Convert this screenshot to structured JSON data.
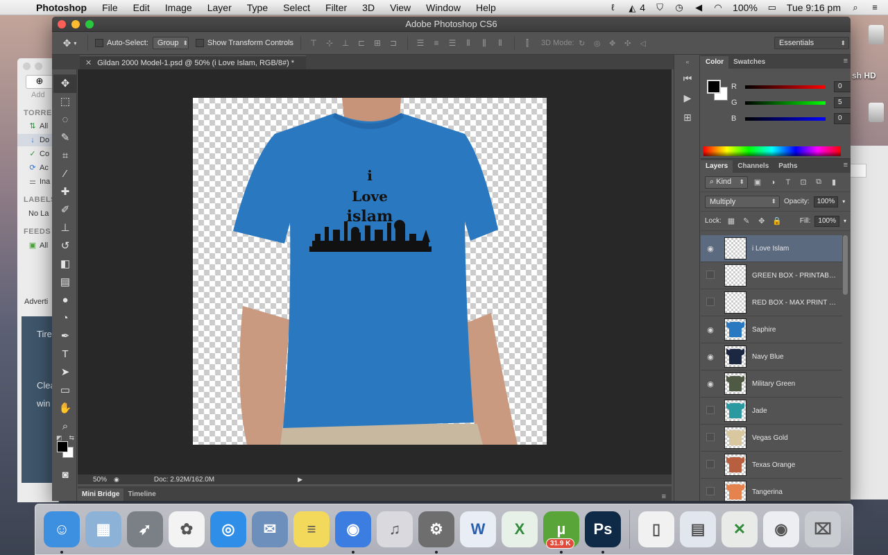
{
  "menubar": {
    "app": "Photoshop",
    "items": [
      "File",
      "Edit",
      "Image",
      "Layer",
      "Type",
      "Select",
      "Filter",
      "3D",
      "View",
      "Window",
      "Help"
    ],
    "adobe_count": "4",
    "battery": "100%",
    "clock": "Tue 9:16 pm"
  },
  "bg_app": {
    "add_label": "Add",
    "sections": [
      "TORRE",
      "LABELS",
      "FEEDS"
    ],
    "rows": [
      "All",
      "Do",
      "Co",
      "Ac",
      "Ina"
    ],
    "label_row": "No La",
    "feed_row": "All",
    "ad_label": "Adverti",
    "ad_lines": [
      "Tire",
      "Clea",
      "win"
    ]
  },
  "desktop": {
    "drive_label": "sh HD"
  },
  "ps": {
    "window_title": "Adobe Photoshop CS6",
    "options": {
      "auto_select": "Auto-Select:",
      "auto_select_value": "Group",
      "show_transform": "Show Transform Controls",
      "mode3d": "3D Mode:",
      "workspace": "Essentials"
    },
    "doc_tab": "Gildan 2000 Model-1.psd @ 50% (i Love Islam, RGB/8#) *",
    "status": {
      "zoom": "50%",
      "doc": "Doc: 2.92M/162.0M"
    },
    "bottom_tabs": [
      "Mini Bridge",
      "Timeline"
    ],
    "artwork": {
      "line1": "i",
      "line2": "Love",
      "line3": "islam",
      "shirt_color": "#2a78c0"
    },
    "color_panel": {
      "tabs": [
        "Color",
        "Swatches"
      ],
      "channels": [
        {
          "label": "R",
          "value": "0",
          "grad": "linear-gradient(90deg,#000,#ff0000)"
        },
        {
          "label": "G",
          "value": "5",
          "grad": "linear-gradient(90deg,#000,#00ff00)"
        },
        {
          "label": "B",
          "value": "0",
          "grad": "linear-gradient(90deg,#000,#0000ff)"
        }
      ]
    },
    "layers_panel": {
      "tabs": [
        "Layers",
        "Channels",
        "Paths"
      ],
      "filter": "Kind",
      "blend_mode": "Multiply",
      "opacity_label": "Opacity:",
      "opacity": "100%",
      "lock_label": "Lock:",
      "fill_label": "Fill:",
      "fill": "100%",
      "layers": [
        {
          "name": "i Love Islam",
          "visible": true,
          "selected": true,
          "color": null
        },
        {
          "name": "GREEN BOX - PRINTABLE ...",
          "visible": false,
          "selected": false,
          "color": null
        },
        {
          "name": "RED BOX - MAX PRINT SIZE",
          "visible": false,
          "selected": false,
          "color": null
        },
        {
          "name": "Saphire",
          "visible": true,
          "selected": false,
          "color": "#2a78c0"
        },
        {
          "name": "Navy Blue",
          "visible": true,
          "selected": false,
          "color": "#1c2741"
        },
        {
          "name": "Military Green",
          "visible": true,
          "selected": false,
          "color": "#4f5a45"
        },
        {
          "name": "Jade",
          "visible": false,
          "selected": false,
          "color": "#2b9aa0"
        },
        {
          "name": "Vegas Gold",
          "visible": false,
          "selected": false,
          "color": "#d9c7a0"
        },
        {
          "name": "Texas Orange",
          "visible": false,
          "selected": false,
          "color": "#b75f3f"
        },
        {
          "name": "Tangerina",
          "visible": false,
          "selected": false,
          "color": "#e5834f"
        }
      ]
    }
  },
  "dock": {
    "apps": [
      {
        "name": "finder",
        "color": "#3d8fe0",
        "glyph": "☺"
      },
      {
        "name": "preview",
        "color": "#8db2d8",
        "glyph": "▦"
      },
      {
        "name": "launchpad",
        "color": "#7b7f86",
        "glyph": "➶"
      },
      {
        "name": "photos",
        "color": "#f3f3f3",
        "glyph": "✿"
      },
      {
        "name": "safari",
        "color": "#2f8ee8",
        "glyph": "◎"
      },
      {
        "name": "mail",
        "color": "#6d8fbc",
        "glyph": "✉"
      },
      {
        "name": "notes",
        "color": "#f2d95c",
        "glyph": "≡"
      },
      {
        "name": "chrome",
        "color": "#3b7de0",
        "glyph": "◉"
      },
      {
        "name": "itunes",
        "color": "#d9d9de",
        "glyph": "♫"
      },
      {
        "name": "system-preferences",
        "color": "#6e6e6e",
        "glyph": "⚙"
      },
      {
        "name": "word",
        "color": "#e9eef6",
        "glyph": "W"
      },
      {
        "name": "excel",
        "color": "#e7f1e7",
        "glyph": "X"
      },
      {
        "name": "utorrent",
        "color": "#5aa53a",
        "glyph": "µ",
        "badge": "31.9 K"
      },
      {
        "name": "photoshop",
        "color": "#0f2a46",
        "glyph": "Ps"
      }
    ],
    "stacks": [
      {
        "name": "documents-stack",
        "color": "#f1f1f1",
        "glyph": "▯"
      },
      {
        "name": "downloads-stack",
        "color": "#e2e7ef",
        "glyph": "▤"
      },
      {
        "name": "recent-excel-stack",
        "color": "#e8ebe8",
        "glyph": "✕"
      },
      {
        "name": "recent-chrome-stack",
        "color": "#eceef1",
        "glyph": "◉"
      },
      {
        "name": "trash",
        "color": "#c9ccd1",
        "glyph": "⌧"
      }
    ]
  }
}
